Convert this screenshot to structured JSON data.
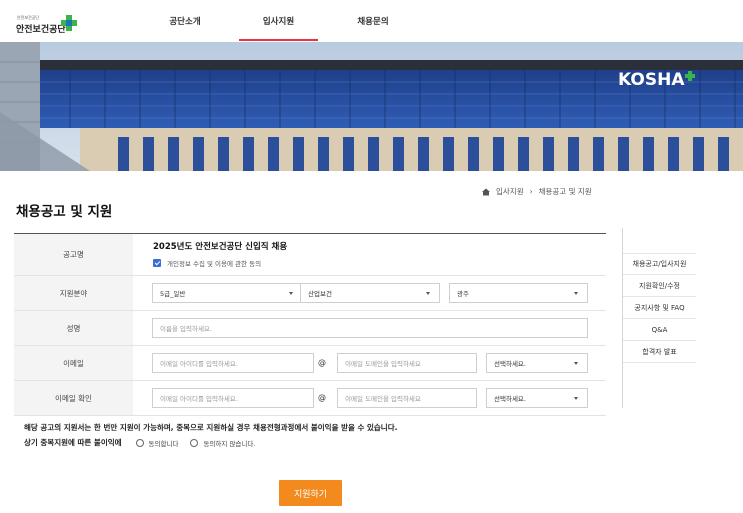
{
  "header": {
    "logo_small": "안전보건공단",
    "logo_main": "안전보건공단",
    "nav": [
      "공단소개",
      "입사지원",
      "채용문의"
    ],
    "active_nav": "입사지원"
  },
  "hero": {
    "sign_text": "KOSHA"
  },
  "breadcrumb": {
    "items": [
      "입사지원",
      "채용공고 및 지원"
    ],
    "separator": "›"
  },
  "page_title": "채용공고 및 지원",
  "form": {
    "posting": {
      "label": "공고명",
      "title": "2025년도 안전보건공단 신입직 채용",
      "consent_checked": true,
      "consent_text": "개인정보 수집 및 이용에 관한 동의"
    },
    "field_of_application": {
      "label": "지원분야",
      "grade": "5급_일반",
      "category": "산업보건",
      "region": "광주"
    },
    "name": {
      "label": "성명",
      "placeholder": "이름을 입력하세요."
    },
    "email": {
      "label": "이메일",
      "id_placeholder": "이메일 아이디를 입력하세요.",
      "at": "@",
      "domain_placeholder": "이메일 도메인을 입력하세요",
      "select": "선택하세요."
    },
    "email_confirm": {
      "label": "이메일 확인",
      "id_placeholder": "이메일 아이디를 입력하세요.",
      "at": "@",
      "domain_placeholder": "이메일 도메인을 입력하세요",
      "select": "선택하세요."
    }
  },
  "notice": "해당 공고의 지원서는 한 번만 지원이 가능하며, 중복으로 지원하실 경우 채용전형과정에서 불이익을 받을 수 있습니다.",
  "duplicate": {
    "label": "상기 중복지원에 따른 불이익에",
    "agree": "동의합니다",
    "disagree": "동의하지 않습니다."
  },
  "submit_label": "지원하기",
  "side_menu": [
    "채용공고/입사지원",
    "지원확인/수정",
    "공지사항 및 FAQ",
    "Q&A",
    "합격자 발표"
  ],
  "colors": {
    "accent": "#f28a1e",
    "nav_underline": "#e7343f",
    "checkbox": "#3a6fd8"
  }
}
